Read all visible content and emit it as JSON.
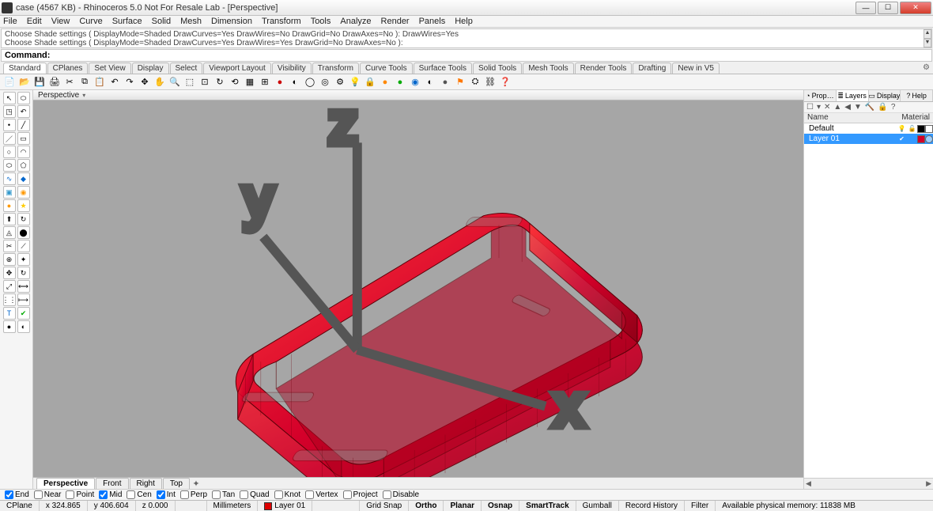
{
  "window": {
    "title": "case (4567 KB) - Rhinoceros 5.0 Not For Resale Lab - [Perspective]"
  },
  "menu": [
    "File",
    "Edit",
    "View",
    "Curve",
    "Surface",
    "Solid",
    "Mesh",
    "Dimension",
    "Transform",
    "Tools",
    "Analyze",
    "Render",
    "Panels",
    "Help"
  ],
  "history": {
    "line1": "Choose Shade settings ( DisplayMode=Shaded  DrawCurves=Yes  DrawWires=No  DrawGrid=No  DrawAxes=No ): DrawWires=Yes",
    "line2": "Choose Shade settings ( DisplayMode=Shaded  DrawCurves=Yes  DrawWires=Yes  DrawGrid=No  DrawAxes=No ):"
  },
  "command_prompt": "Command:",
  "tool_tabs": [
    "Standard",
    "CPlanes",
    "Set View",
    "Display",
    "Select",
    "Viewport Layout",
    "Visibility",
    "Transform",
    "Curve Tools",
    "Surface Tools",
    "Solid Tools",
    "Mesh Tools",
    "Render Tools",
    "Drafting",
    "New in V5"
  ],
  "viewport": {
    "title": "Perspective",
    "axes": {
      "x": "x",
      "y": "y",
      "z": "z"
    }
  },
  "viewport_tabs": [
    "Perspective",
    "Front",
    "Right",
    "Top"
  ],
  "right_panel": {
    "tabs": [
      "Prop…",
      "Layers",
      "Display",
      "Help"
    ],
    "header": {
      "name": "Name",
      "material": "Material"
    },
    "layers": [
      {
        "name": "Default",
        "visible": true,
        "locked": false,
        "color": "#000000",
        "selected": false
      },
      {
        "name": "Layer 01",
        "visible": true,
        "locked": false,
        "color": "#d4002a",
        "selected": true,
        "mat": "#9ecfff"
      }
    ]
  },
  "osnap": [
    {
      "label": "End",
      "checked": true
    },
    {
      "label": "Near",
      "checked": false
    },
    {
      "label": "Point",
      "checked": false
    },
    {
      "label": "Mid",
      "checked": true
    },
    {
      "label": "Cen",
      "checked": false
    },
    {
      "label": "Int",
      "checked": true
    },
    {
      "label": "Perp",
      "checked": false
    },
    {
      "label": "Tan",
      "checked": false
    },
    {
      "label": "Quad",
      "checked": false
    },
    {
      "label": "Knot",
      "checked": false
    },
    {
      "label": "Vertex",
      "checked": false
    },
    {
      "label": "Project",
      "checked": false
    },
    {
      "label": "Disable",
      "checked": false
    }
  ],
  "status": {
    "cplane": "CPlane",
    "x": "x 324.865",
    "y": "y 406.604",
    "z": "z 0.000",
    "units": "Millimeters",
    "layer": "Layer 01",
    "grid": "Grid Snap",
    "ortho": "Ortho",
    "planar": "Planar",
    "osnap": "Osnap",
    "smart": "SmartTrack",
    "gumball": "Gumball",
    "record": "Record History",
    "filter": "Filter",
    "memory": "Available physical memory: 11838 MB"
  }
}
